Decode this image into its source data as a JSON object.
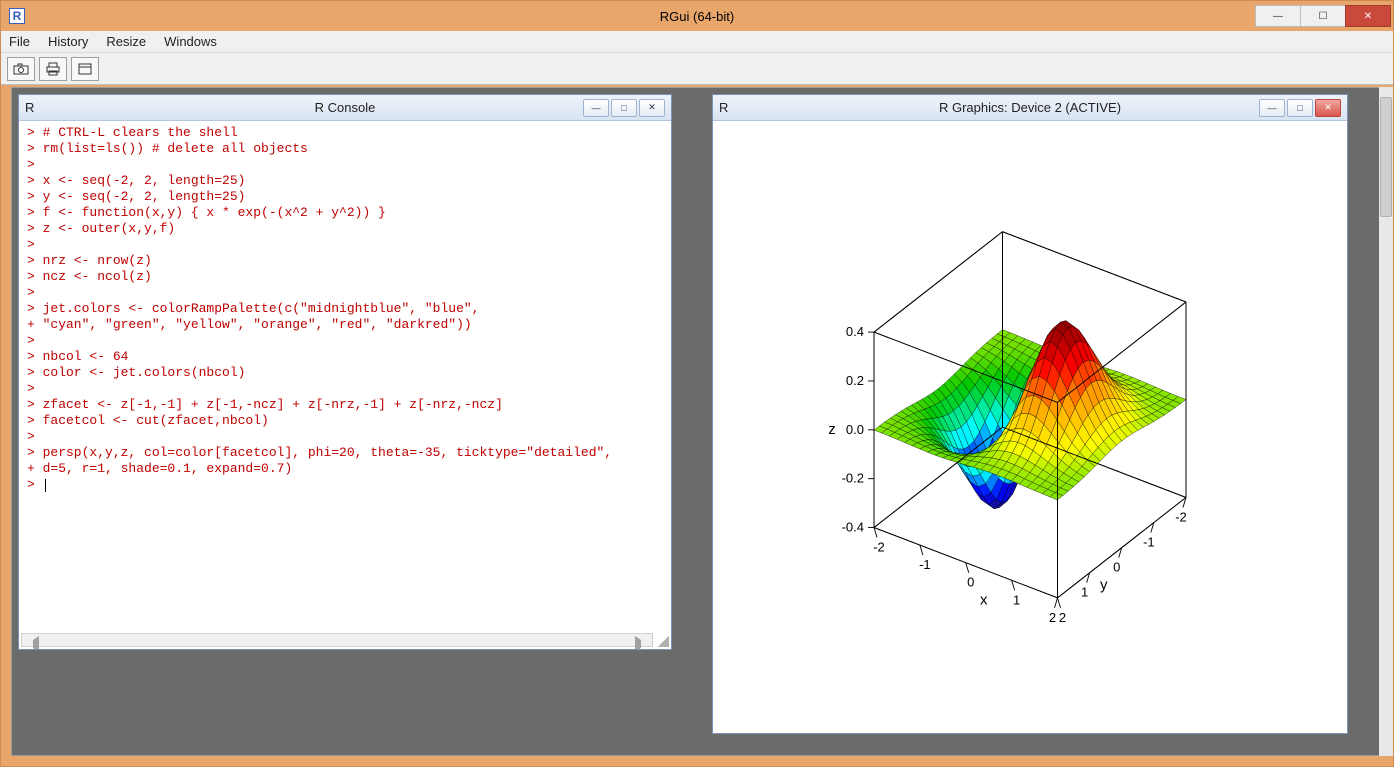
{
  "app": {
    "title": "RGui (64-bit)",
    "menus": [
      "File",
      "History",
      "Resize",
      "Windows"
    ]
  },
  "child_windows": {
    "console": {
      "title": "R Console"
    },
    "graphics": {
      "title": "R Graphics: Device 2 (ACTIVE)"
    }
  },
  "console_lines": [
    "> # CTRL-L clears the shell",
    "> rm(list=ls()) # delete all objects",
    ">",
    "> x <- seq(-2, 2, length=25)",
    "> y <- seq(-2, 2, length=25)",
    "> f <- function(x,y) { x * exp(-(x^2 + y^2)) }",
    "> z <- outer(x,y,f)",
    ">",
    "> nrz <- nrow(z)",
    "> ncz <- ncol(z)",
    ">",
    "> jet.colors <- colorRampPalette(c(\"midnightblue\", \"blue\",",
    "+ \"cyan\", \"green\", \"yellow\", \"orange\", \"red\", \"darkred\"))",
    ">",
    "> nbcol <- 64",
    "> color <- jet.colors(nbcol)",
    ">",
    "> zfacet <- z[-1,-1] + z[-1,-ncz] + z[-nrz,-1] + z[-nrz,-ncz]",
    "> facetcol <- cut(zfacet,nbcol)",
    ">",
    "> persp(x,y,z, col=color[facetcol], phi=20, theta=-35, ticktype=\"detailed\",",
    "+ d=5, r=1, shade=0.1, expand=0.7)",
    "> "
  ],
  "chart_data": {
    "type": "surface3d",
    "title": "",
    "x": {
      "label": "x",
      "min": -2,
      "max": 2,
      "ticks": [
        -2,
        -1,
        0,
        1,
        2
      ],
      "n": 25
    },
    "y": {
      "label": "y",
      "min": -2,
      "max": 2,
      "ticks": [
        -2,
        -1,
        0,
        1,
        2
      ],
      "n": 25
    },
    "z": {
      "label": "z",
      "min": -0.4,
      "max": 0.4,
      "ticks": [
        -0.4,
        -0.2,
        0.0,
        0.2,
        0.4
      ]
    },
    "function": "z = x * exp(-(x^2 + y^2))",
    "view": {
      "phi": 20,
      "theta": -35,
      "d": 5,
      "r": 1,
      "shade": 0.1,
      "expand": 0.7
    },
    "colormap": [
      "midnightblue",
      "blue",
      "cyan",
      "green",
      "yellow",
      "orange",
      "red",
      "darkred"
    ],
    "ncolors": 64
  }
}
